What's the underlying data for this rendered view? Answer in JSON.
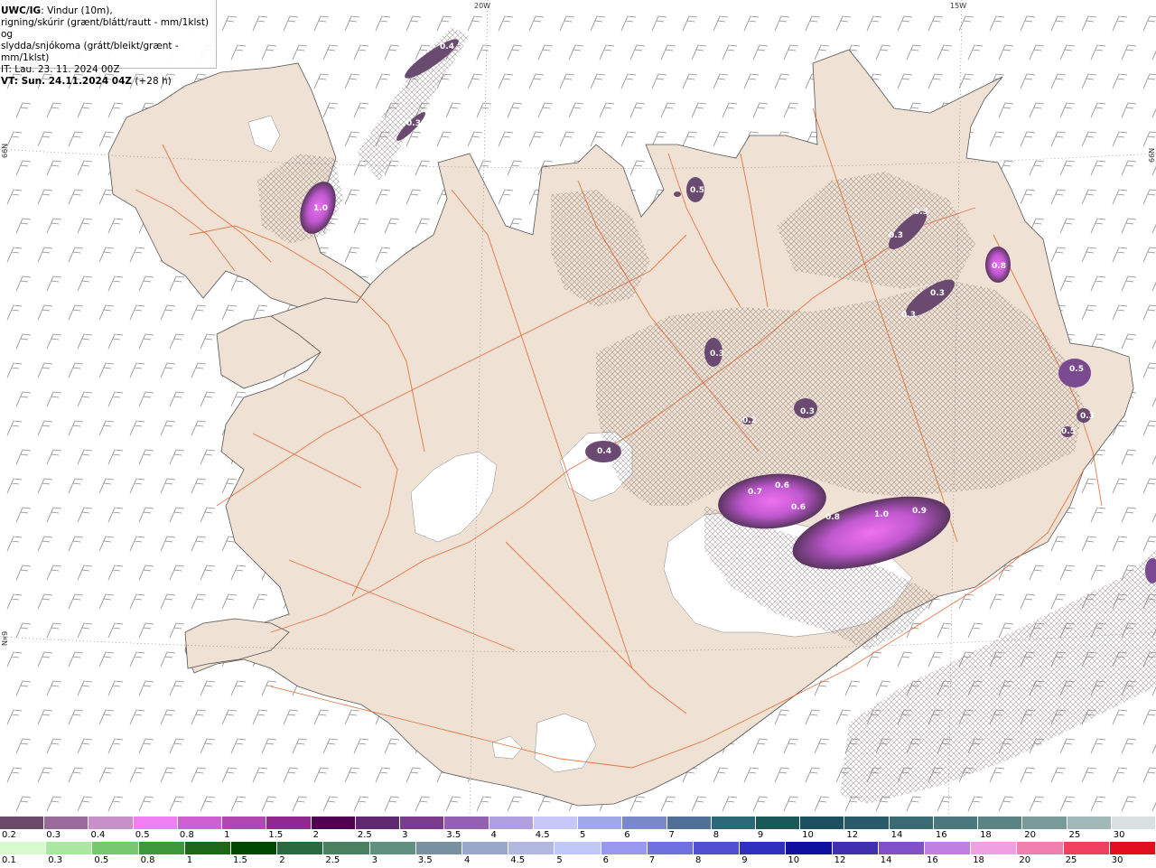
{
  "header": {
    "model": "UWC/IG",
    "line1_rest": ": Vindur (10m),",
    "line2": "rigning/skúrir (grænt/blátt/rautt - mm/1klst) og",
    "line3": "slydda/snjókoma (grátt/bleikt/grænt - mm/1klst)",
    "line4": "IT: Lau. 23. 11. 2024 00Z",
    "line5_bold": "VT: Sun. 24.11.2024 04Z",
    "line5_rest": " (+28 h)"
  },
  "graticule": {
    "lon_20w": "20W",
    "lon_15w": "15W",
    "lat_left": "66N",
    "lat_right": "66N",
    "lat_left_low": "N¤9"
  },
  "precip_labels": [
    "0.4",
    "0.3",
    "1.0",
    "0.5",
    "0.3",
    "0.3",
    "0.8",
    "0.3",
    "0.3",
    "0.3",
    "0.5",
    "0.3",
    "0.3",
    "0.4",
    "0.7",
    "0.6",
    "0.6",
    "0.8",
    "1.0",
    "0.9",
    "0.2",
    "0.5"
  ],
  "colors": {
    "land": "#efe1d3",
    "roads": "#e3622a",
    "ice": "#ffffff",
    "sea": "#ffffff",
    "barbs": "#8a8a8a",
    "snow_light": "#d68ee8",
    "snow_mid": "#b050c0",
    "snow_dark": "#5a3560"
  },
  "snow_scale": {
    "labels": [
      "0.2",
      "0.3",
      "0.4",
      "0.5",
      "0.8",
      "1",
      "1.5",
      "2",
      "2.5",
      "3",
      "3.5",
      "4",
      "4.5",
      "5",
      "6",
      "7",
      "8",
      "9",
      "10",
      "12",
      "14",
      "16",
      "18",
      "20",
      "25",
      "30"
    ],
    "colors": [
      "#6a4a6a",
      "#9a6a9a",
      "#c890c8",
      "#f080f0",
      "#d060d0",
      "#b048b0",
      "#902890",
      "#500050",
      "#602870",
      "#7a3c8a",
      "#9460b0",
      "#b0a0e0",
      "#c8c8f8",
      "#a0a8e8",
      "#7888c8",
      "#507098",
      "#2c6878",
      "#1c5858",
      "#1c5060",
      "#285a6a",
      "#3a6a72",
      "#4a787c",
      "#5a8484",
      "#7a9a9a",
      "#a0b8b8",
      "#d8e0e0"
    ]
  },
  "rain_scale": {
    "labels": [
      "0.1",
      "0.3",
      "0.5",
      "0.8",
      "1",
      "1.5",
      "2",
      "2.5",
      "3",
      "3.5",
      "4",
      "4.5",
      "5",
      "6",
      "7",
      "8",
      "9",
      "10",
      "12",
      "14",
      "16",
      "18",
      "20",
      "25",
      "30"
    ],
    "colors": [
      "#d8f8d0",
      "#a8e8a0",
      "#78c870",
      "#3c9838",
      "#1c6818",
      "#004800",
      "#2a6a40",
      "#4a8060",
      "#609080",
      "#7890a0",
      "#98a8c8",
      "#b0b8e0",
      "#c0c8f8",
      "#9898f0",
      "#7070e0",
      "#5050d0",
      "#3030c0",
      "#1010a0",
      "#4030b0",
      "#8050c8",
      "#c080e0",
      "#f0a0e0",
      "#f080b0",
      "#f04060",
      "#e01020"
    ]
  }
}
